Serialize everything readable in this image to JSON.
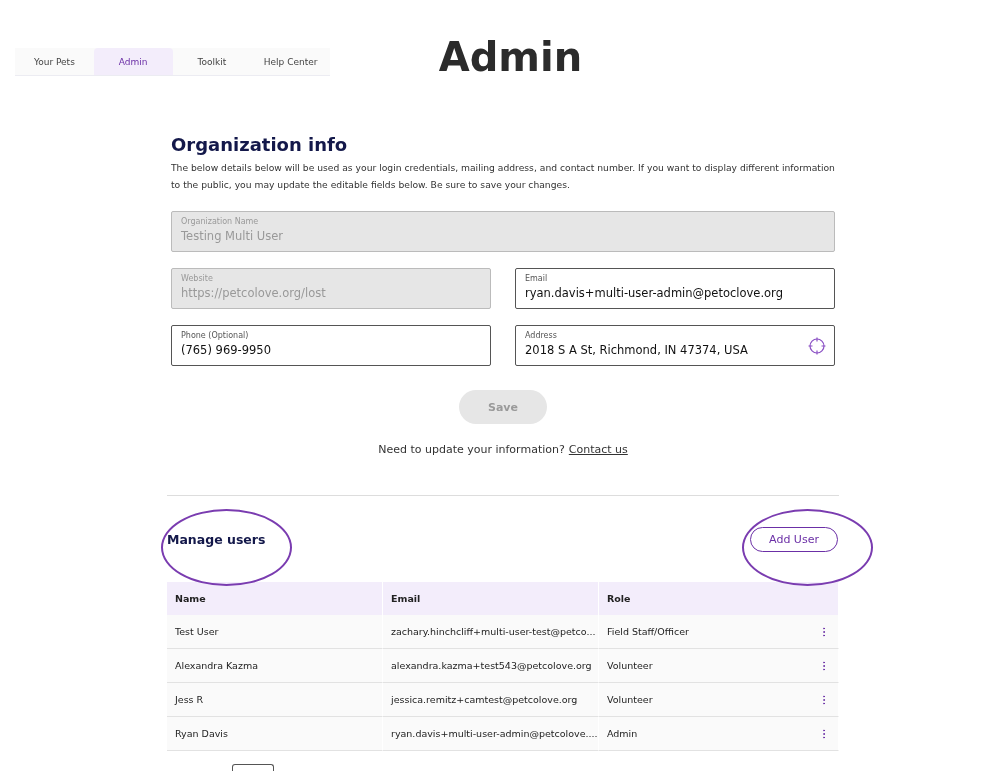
{
  "tabs": [
    {
      "label": "Your Pets",
      "selected": false
    },
    {
      "label": "Admin",
      "selected": true
    },
    {
      "label": "Toolkit",
      "selected": false
    },
    {
      "label": "Help Center",
      "selected": false
    }
  ],
  "page_title": "Admin",
  "organization_info": {
    "heading": "Organization info",
    "description": "The below details below will be used as your login credentials, mailing address, and contact number. If you want to display different information to the public, you may update the editable fields below. Be sure to save your changes.",
    "fields": [
      {
        "label": "Organization Name",
        "value": "Testing Multi User",
        "disabled": true,
        "kind": "text"
      },
      {
        "label": "Website",
        "value": "https://petcolove.org/lost",
        "disabled": true,
        "kind": "text"
      },
      {
        "label": "Email",
        "value": "ryan.davis+multi-user-admin@petoclove.org",
        "disabled": false,
        "kind": "text"
      },
      {
        "label": "Phone (Optional)",
        "value": "(765) 969-9950",
        "disabled": false,
        "kind": "text"
      },
      {
        "label": "Address",
        "value": "2018 S A St, Richmond, IN 47374, USA",
        "disabled": false,
        "kind": "location"
      }
    ],
    "save_button": {
      "label": "Save",
      "disabled": true
    },
    "help_text": "Need to update your information?",
    "contact_link": "Contact us"
  },
  "manage_users": {
    "heading": "Manage users",
    "add_button": "Add User",
    "table": {
      "columns": [
        "Name",
        "Email",
        "Role"
      ],
      "rows": [
        {
          "name": "Test User",
          "email": "zachary.hinchcliff+multi-user-test@petco...",
          "role": "Field Staff/Officer"
        },
        {
          "name": "Alexandra Kazma",
          "email": "alexandra.kazma+test543@petcolove.org",
          "role": "Volunteer"
        },
        {
          "name": "Jess R",
          "email": "jessica.remitz+camtest@petcolove.org",
          "role": "Volunteer"
        },
        {
          "name": "Ryan Davis",
          "email": "ryan.davis+multi-user-admin@petcolove....",
          "role": "Admin"
        }
      ]
    }
  }
}
